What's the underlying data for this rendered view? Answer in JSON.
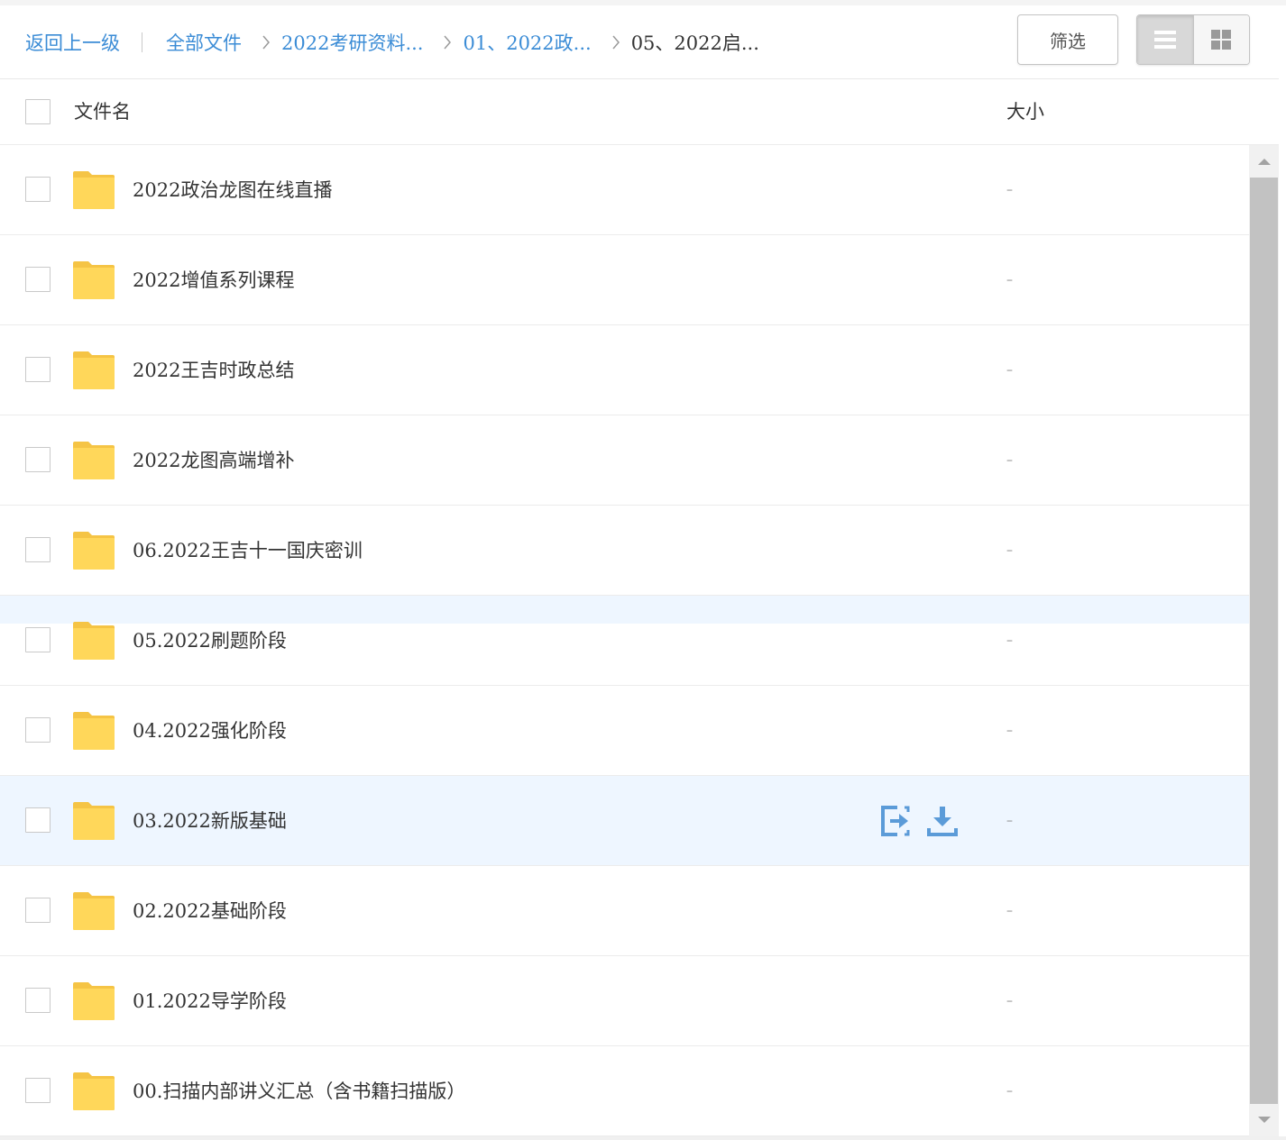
{
  "breadcrumb": {
    "back": "返回上一级",
    "items": [
      {
        "label": "全部文件"
      },
      {
        "label": "2022考研资料..."
      },
      {
        "label": "01、2022政..."
      },
      {
        "label": "05、2022启..."
      }
    ]
  },
  "toolbar": {
    "filter_label": "筛选",
    "view_modes": [
      "list-icon",
      "grid-icon"
    ],
    "active_view": "list"
  },
  "header": {
    "name_label": "文件名",
    "size_label": "大小"
  },
  "files": [
    {
      "name": "2022政治龙图在线直播",
      "size": "–",
      "type": "folder"
    },
    {
      "name": "2022增值系列课程",
      "size": "–",
      "type": "folder"
    },
    {
      "name": "2022王吉时政总结",
      "size": "–",
      "type": "folder"
    },
    {
      "name": "2022龙图高端增补",
      "size": "–",
      "type": "folder"
    },
    {
      "name": "06.2022王吉十一国庆密训",
      "size": "–",
      "type": "folder"
    },
    {
      "name": "05.2022刷题阶段",
      "size": "–",
      "type": "folder"
    },
    {
      "name": "04.2022强化阶段",
      "size": "–",
      "type": "folder"
    },
    {
      "name": "03.2022新版基础",
      "size": "–",
      "type": "folder",
      "hovered": true
    },
    {
      "name": "02.2022基础阶段",
      "size": "–",
      "type": "folder"
    },
    {
      "name": "01.2022导学阶段",
      "size": "–",
      "type": "folder"
    },
    {
      "name": "00.扫描内部讲义汇总（含书籍扫描版）",
      "size": "–",
      "type": "folder"
    }
  ],
  "row_actions": [
    "share-icon",
    "download-icon"
  ],
  "colors": {
    "link": "#3b8cd6",
    "folder": "#ffd75a",
    "folder_tab": "#f5c445",
    "hover_row": "#eef6ff",
    "action_icon": "#5b9bd8"
  }
}
